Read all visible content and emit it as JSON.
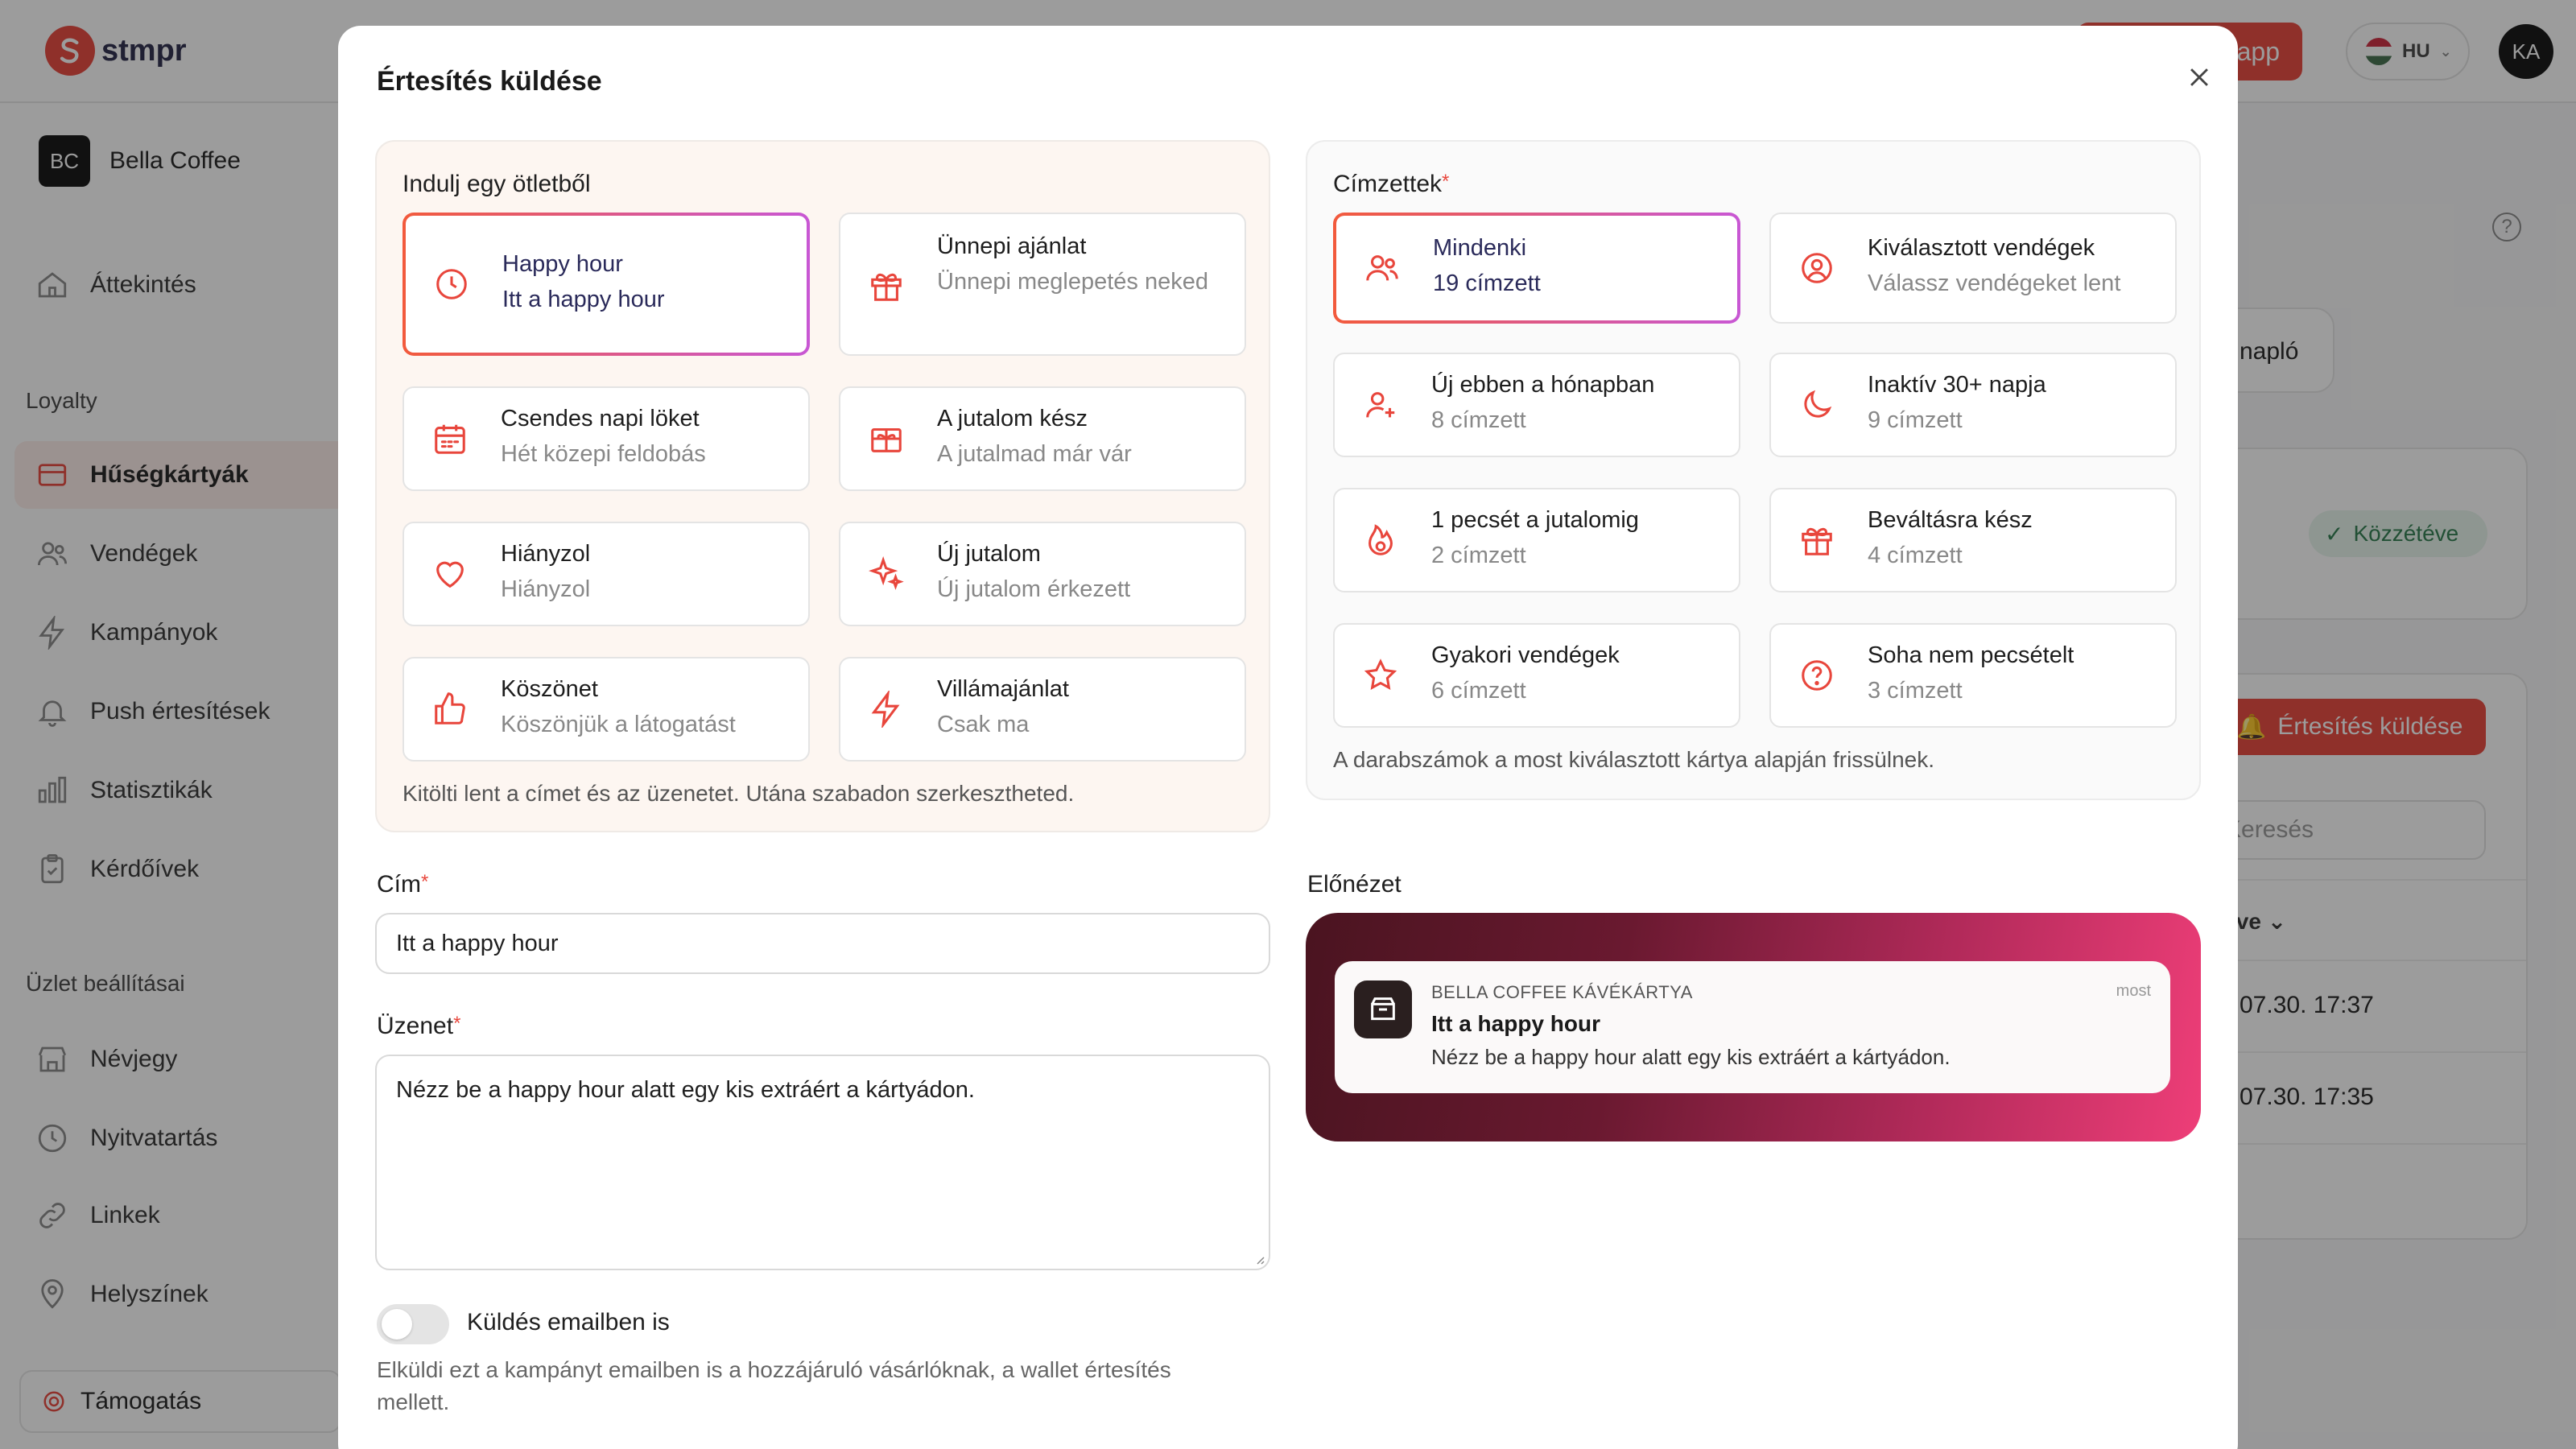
{
  "app": {
    "logo_text": "stmpr",
    "top_button": "app",
    "language": "HU",
    "user_initials": "KA"
  },
  "sidebar": {
    "business_initials": "BC",
    "business_name": "Bella Coffee",
    "overview": "Áttekintés",
    "section_loyalty": "Loyalty",
    "items": [
      {
        "label": "Hűségkártyák",
        "icon": "card-icon"
      },
      {
        "label": "Vendégek",
        "icon": "users-icon"
      },
      {
        "label": "Kampányok",
        "icon": "bolt-icon"
      },
      {
        "label": "Push értesítések",
        "icon": "bell-icon"
      },
      {
        "label": "Statisztikák",
        "icon": "bar-chart-icon"
      },
      {
        "label": "Kérdőívek",
        "icon": "clipboard-icon"
      }
    ],
    "section_settings": "Üzlet beállításai",
    "settings_items": [
      {
        "label": "Névjegy",
        "icon": "store-icon"
      },
      {
        "label": "Nyitvatartás",
        "icon": "clock-icon"
      },
      {
        "label": "Linkek",
        "icon": "link-icon"
      },
      {
        "label": "Helyszínek",
        "icon": "pin-icon"
      }
    ],
    "support": "Támogatás"
  },
  "background": {
    "log_tab": "napló",
    "status_badge": "Közzétéve",
    "send_button": "Értesítés küldése",
    "search_placeholder": "Keresés",
    "column_header": "lve",
    "rows": [
      "07.30. 17:37",
      "07.30. 17:35"
    ]
  },
  "modal": {
    "title": "Értesítés küldése",
    "ideas": {
      "title": "Indulj egy ötletből",
      "options": [
        {
          "title": "Happy hour",
          "subtitle": "Itt a happy hour",
          "icon": "clock-icon",
          "selected": true
        },
        {
          "title": "Ünnepi ajánlat",
          "subtitle": "Ünnepi meglepetés neked",
          "icon": "gift-icon",
          "selected": false
        },
        {
          "title": "Csendes napi löket",
          "subtitle": "Hét közepi feldobás",
          "icon": "calendar-icon",
          "selected": false
        },
        {
          "title": "A jutalom kész",
          "subtitle": "A jutalmad már vár",
          "icon": "gift-box-icon",
          "selected": false
        },
        {
          "title": "Hiányzol",
          "subtitle": "Hiányzol",
          "icon": "heart-icon",
          "selected": false
        },
        {
          "title": "Új jutalom",
          "subtitle": "Új jutalom érkezett",
          "icon": "sparkles-icon",
          "selected": false
        },
        {
          "title": "Köszönet",
          "subtitle": "Köszönjük a látogatást",
          "icon": "thumbs-up-icon",
          "selected": false
        },
        {
          "title": "Villámajánlat",
          "subtitle": "Csak ma",
          "icon": "bolt-icon",
          "selected": false
        }
      ],
      "note": "Kitölti lent a címet és az üzenetet. Utána szabadon szerkesztheted."
    },
    "recipients": {
      "title": "Címzettek",
      "required_mark": "*",
      "options": [
        {
          "title": "Mindenki",
          "subtitle": "19 címzett",
          "icon": "users-icon",
          "selected": true
        },
        {
          "title": "Kiválasztott vendégek",
          "subtitle": "Válassz vendégeket lent",
          "icon": "user-circle-icon",
          "selected": false
        },
        {
          "title": "Új ebben a hónapban",
          "subtitle": "8 címzett",
          "icon": "user-plus-icon",
          "selected": false
        },
        {
          "title": "Inaktív 30+ napja",
          "subtitle": "9 címzett",
          "icon": "moon-icon",
          "selected": false
        },
        {
          "title": "1 pecsét a jutalomig",
          "subtitle": "2 címzett",
          "icon": "flame-icon",
          "selected": false
        },
        {
          "title": "Beváltásra kész",
          "subtitle": "4 címzett",
          "icon": "gift-icon",
          "selected": false
        },
        {
          "title": "Gyakori vendégek",
          "subtitle": "6 címzett",
          "icon": "star-icon",
          "selected": false
        },
        {
          "title": "Soha nem pecsételt",
          "subtitle": "3 címzett",
          "icon": "question-circle-icon",
          "selected": false
        }
      ],
      "note": "A darabszámok a most kiválasztott kártya alapján frissülnek."
    },
    "form": {
      "title_label": "Cím",
      "title_value": "Itt a happy hour",
      "message_label": "Üzenet",
      "message_value": "Nézz be a happy hour alatt egy kis extráért a kártyádon.",
      "required_mark": "*",
      "email_toggle_label": "Küldés emailben is",
      "email_toggle_on": false,
      "email_help": "Elküldi ezt a kampányt emailben is a hozzájáruló vásárlóknak, a wallet értesítés mellett."
    },
    "preview": {
      "label": "Előnézet",
      "app_name": "BELLA COFFEE KÁVÉKÁRTYA",
      "time": "most",
      "title": "Itt a happy hour",
      "body": "Nézz be a happy hour alatt egy kis extráért a kártyádon."
    }
  },
  "colors": {
    "accent": "#e8463c",
    "selected_gradient_start": "#f25a3c",
    "selected_gradient_end": "#c857d4",
    "preview_gradient_start": "#4a1420",
    "preview_gradient_end": "#ee3e78"
  }
}
